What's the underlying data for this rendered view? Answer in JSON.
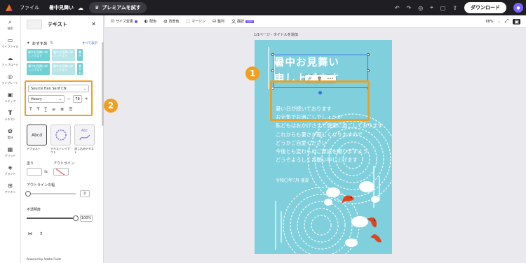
{
  "topbar": {
    "file_menu": "ファイル",
    "doc_name": "暑中見舞い",
    "premium_label": "プレミアムを試す",
    "download_label": "ダウンロード"
  },
  "rail": {
    "items": [
      {
        "label": "検索",
        "icon": "search-icon"
      },
      {
        "label": "マイファイル",
        "icon": "folder-icon"
      },
      {
        "label": "アップロード",
        "icon": "upload-icon"
      },
      {
        "label": "テンプレート",
        "icon": "template-icon"
      },
      {
        "label": "メディア",
        "icon": "media-icon"
      },
      {
        "label": "テキスト",
        "icon": "text-icon"
      },
      {
        "label": "素材",
        "icon": "elements-icon"
      },
      {
        "label": "グリッド",
        "icon": "grid-icon"
      },
      {
        "label": "ブランド",
        "icon": "brand-icon"
      },
      {
        "label": "アドオン",
        "icon": "addon-icon"
      }
    ]
  },
  "panel": {
    "title": "テキスト",
    "recommend_label": "おすすめ",
    "see_all": "すべて表示",
    "rec_tiles": [
      "暑中お見舞い申し上げます",
      "暑中お見舞い申し上げます",
      "暑中お見舞い申し上げます",
      "暑中お見舞い申し上げます",
      "暑中お見舞い申し上げます",
      "暑中"
    ],
    "font_name": "Source Han Serif CN",
    "font_weight": "Heavy",
    "font_size": "79",
    "styles": [
      {
        "preview": "Abcd",
        "caption": "デフォルト"
      },
      {
        "preview": "",
        "caption": "テキストレイアウト"
      },
      {
        "preview": "Abc",
        "caption": "流し込みテキスト"
      }
    ],
    "fill_label": "塗り",
    "outline_label": "アウトライン",
    "outline_width_label": "アウトラインの幅",
    "outline_width_value": "0",
    "opacity_label": "不透明度",
    "opacity_value": "100%",
    "opacity_fraction": 1.0,
    "powered_by": "Powered by Adobe Fonts"
  },
  "toolbar": {
    "items": [
      "サイズ変更",
      "配色",
      "背景色",
      "マージン",
      "整列",
      "翻訳"
    ],
    "new_badge": "NEW",
    "zoom": "68%"
  },
  "canvas": {
    "page_label": "1/1ページ - タイトルを追加",
    "heading_line1": "暑中お見舞い",
    "heading_line2": "申し上げます",
    "poem": [
      "暑い日が続いております",
      "お元気でお過ごしでしょうか",
      "私どもはおかげさまで健康に過ごしております",
      "これからも暑さが厳しくなりますので",
      "どうかご自愛ください",
      "今後とも変わらぬご厚誼を賜りますよう",
      "どうぞよろしくお願い申し上げます"
    ],
    "signoff": "令和〇年7月 盛夏",
    "card_color": "#7fcfdc",
    "highlight_color": "#f0a020",
    "badge1": "1",
    "badge2": "2"
  }
}
